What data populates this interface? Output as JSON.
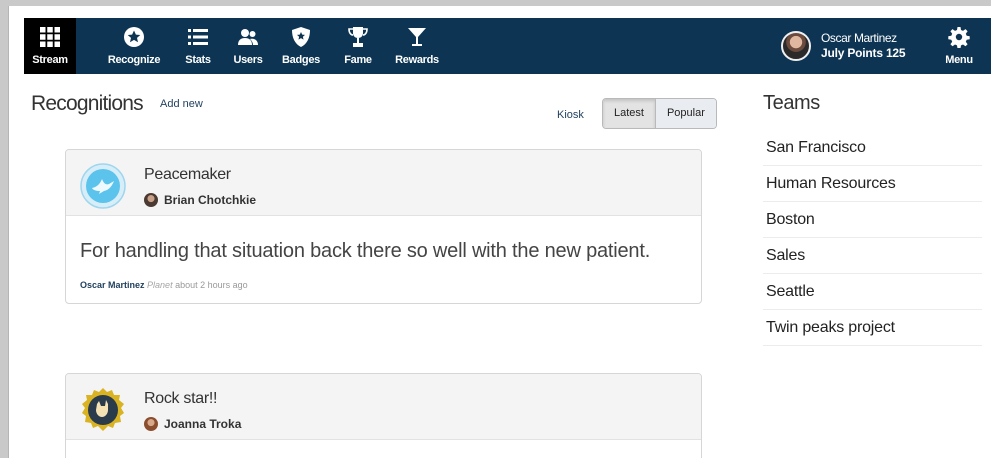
{
  "nav": {
    "items": [
      {
        "label": "Stream",
        "icon": "grid-icon"
      },
      {
        "label": "Recognize",
        "icon": "star-circle-icon"
      },
      {
        "label": "Stats",
        "icon": "list-icon"
      },
      {
        "label": "Users",
        "icon": "users-icon"
      },
      {
        "label": "Badges",
        "icon": "shield-icon"
      },
      {
        "label": "Fame",
        "icon": "trophy-icon"
      },
      {
        "label": "Rewards",
        "icon": "cocktail-icon"
      }
    ],
    "menu_label": "Menu"
  },
  "profile": {
    "name": "Oscar Martinez",
    "points": "July Points 125"
  },
  "main": {
    "title": "Recognitions",
    "add_new": "Add new",
    "kiosk": "Kiosk",
    "sort": {
      "latest": "Latest",
      "popular": "Popular",
      "active": "Latest"
    }
  },
  "recognitions": [
    {
      "badge": "Peacemaker",
      "badge_icon": "dove-icon",
      "recipient": "Brian Chotchkie",
      "message": "For handling that situation back there so well with the new patient.",
      "sender": "Oscar Martinez",
      "team": "Planet",
      "time": "about 2 hours ago"
    },
    {
      "badge": "Rock star!!",
      "badge_icon": "rock-hand-icon",
      "recipient": "Joanna Troka"
    }
  ],
  "teams": {
    "title": "Teams",
    "items": [
      "San Francisco",
      "Human Resources",
      "Boston",
      "Sales",
      "Seattle",
      "Twin peaks project"
    ]
  },
  "colors": {
    "nav_bg": "#0d3553",
    "nav_active": "#000000",
    "link": "#1e3e5c"
  }
}
